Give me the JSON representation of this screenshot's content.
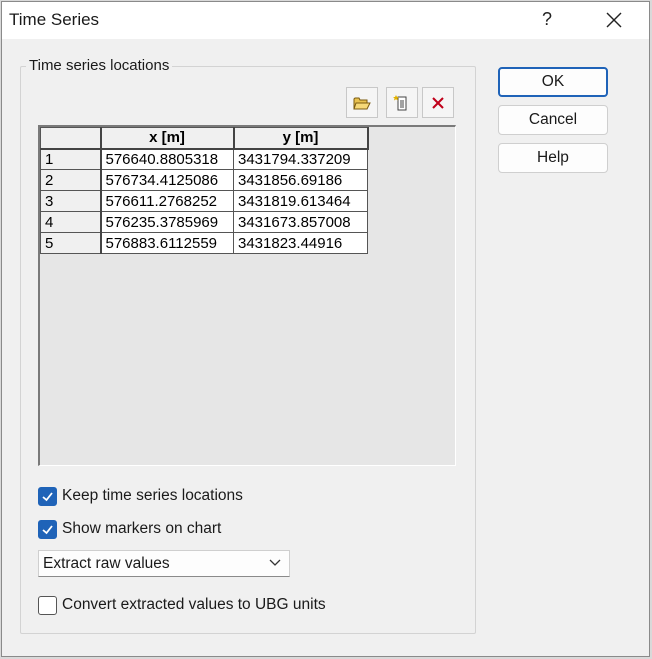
{
  "window": {
    "title": "Time Series",
    "help_glyph": "?"
  },
  "group": {
    "label": "Time series locations"
  },
  "toolbar": {
    "open_icon": "folder-open-icon",
    "new_icon": "new-document-icon",
    "delete_icon": "delete-x-icon"
  },
  "table": {
    "columns": [
      "",
      "x [m]",
      "y [m]"
    ],
    "rows": [
      {
        "id": "1",
        "x": "576640.8805318",
        "y": "3431794.337209"
      },
      {
        "id": "2",
        "x": "576734.4125086",
        "y": "3431856.69186"
      },
      {
        "id": "3",
        "x": "576611.2768252",
        "y": "3431819.613464"
      },
      {
        "id": "4",
        "x": "576235.3785969",
        "y": "3431673.857008"
      },
      {
        "id": "5",
        "x": "576883.6112559",
        "y": "3431823.44916"
      }
    ]
  },
  "options": {
    "keep_locations": {
      "label": "Keep time series locations",
      "checked": true
    },
    "show_markers": {
      "label": "Show markers on chart",
      "checked": true
    },
    "extract_mode": {
      "selected": "Extract raw values"
    },
    "convert_units": {
      "label": "Convert extracted values to UBG units",
      "checked": false
    }
  },
  "buttons": {
    "ok": "OK",
    "cancel": "Cancel",
    "help": "Help"
  },
  "colors": {
    "accent": "#1f63b8",
    "delete": "#c0001a"
  }
}
